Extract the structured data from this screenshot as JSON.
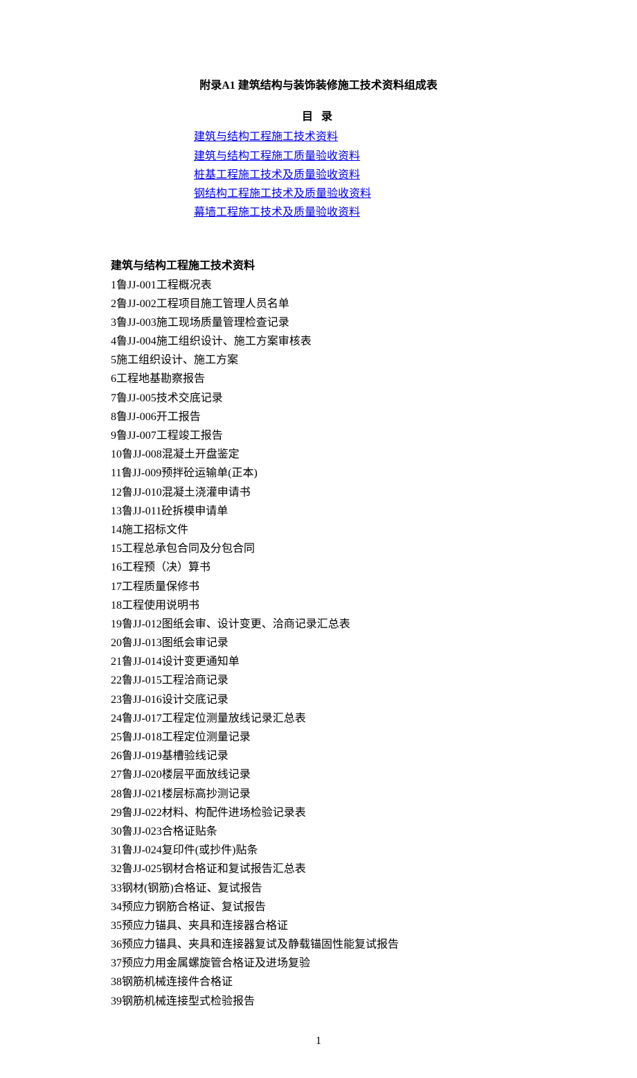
{
  "title": "附录A1 建筑结构与装饰装修施工技术资料组成表",
  "toc_header": "目 录",
  "toc": [
    "建筑与结构工程施工技术资料",
    "建筑与结构工程施工质量验收资料",
    "桩基工程施工技术及质量验收资料",
    "钢结构工程施工技术及质量验收资料",
    "幕墙工程施工技术及质量验收资料"
  ],
  "section_heading": "建筑与结构工程施工技术资料",
  "items": [
    "1鲁JJ-001工程概况表",
    "2鲁JJ-002工程项目施工管理人员名单",
    "3鲁JJ-003施工现场质量管理检查记录",
    "4鲁JJ-004施工组织设计、施工方案审核表",
    "5施工组织设计、施工方案",
    "6工程地基勘察报告",
    "7鲁JJ-005技术交底记录",
    "8鲁JJ-006开工报告",
    "9鲁JJ-007工程竣工报告",
    "10鲁JJ-008混凝土开盘鉴定",
    "11鲁JJ-009预拌砼运输单(正本)",
    "12鲁JJ-010混凝土浇灌申请书",
    "13鲁JJ-011砼拆模申请单",
    "14施工招标文件",
    "15工程总承包合同及分包合同",
    "16工程预（决）算书",
    "17工程质量保修书",
    "18工程使用说明书",
    "19鲁JJ-012图纸会审、设计变更、洽商记录汇总表",
    "20鲁JJ-013图纸会审记录",
    "21鲁JJ-014设计变更通知单",
    "22鲁JJ-015工程洽商记录",
    "23鲁JJ-016设计交底记录",
    "24鲁JJ-017工程定位测量放线记录汇总表",
    "25鲁JJ-018工程定位测量记录",
    "26鲁JJ-019基槽验线记录",
    "27鲁JJ-020楼层平面放线记录",
    "28鲁JJ-021楼层标高抄测记录",
    "29鲁JJ-022材料、构配件进场检验记录表",
    "30鲁JJ-023合格证贴条",
    "31鲁JJ-024复印件(或抄件)贴条",
    "32鲁JJ-025钢材合格证和复试报告汇总表",
    "33钢材(钢筋)合格证、复试报告",
    "34预应力钢筋合格证、复试报告",
    "35预应力锚具、夹具和连接器合格证",
    "36预应力锚具、夹具和连接器复试及静载锚固性能复试报告",
    "37预应力用金属螺旋管合格证及进场复验",
    "38钢筋机械连接件合格证",
    "39钢筋机械连接型式检验报告"
  ],
  "page_number": "1"
}
